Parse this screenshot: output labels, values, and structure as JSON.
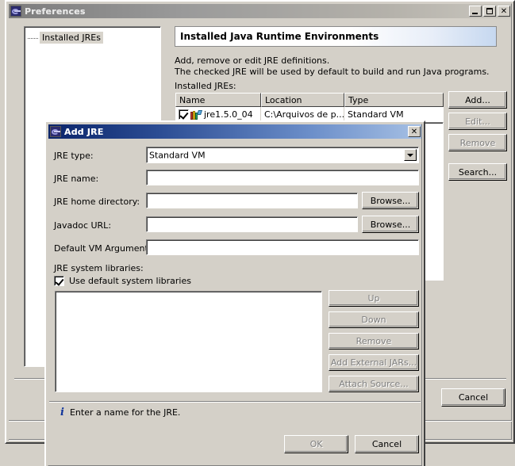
{
  "preferences_window": {
    "title": "Preferences",
    "icon": "eclipse-icon",
    "titlebar_buttons": [
      {
        "name": "minimize-button",
        "label": "_"
      },
      {
        "name": "maximize-button",
        "label": "□"
      },
      {
        "name": "close-button",
        "label": "✕"
      }
    ],
    "tree": {
      "items": [
        {
          "label": "Installed JREs",
          "selected": true
        }
      ]
    },
    "page": {
      "banner_title": "Installed Java Runtime Environments",
      "description_line1": "Add, remove or edit JRE definitions.",
      "description_line2": "The checked JRE will be used by default to build and run Java programs.",
      "table_label": "Installed JREs:",
      "table": {
        "columns": [
          "Name",
          "Location",
          "Type"
        ],
        "rows": [
          {
            "checked": true,
            "name": "jre1.5.0_04",
            "location": "C:\\Arquivos de p...",
            "type": "Standard VM"
          }
        ]
      },
      "side_buttons": [
        {
          "label": "Add...",
          "enabled": true,
          "name": "add-jre-button"
        },
        {
          "label": "Edit...",
          "enabled": false,
          "name": "edit-jre-button"
        },
        {
          "label": "Remove",
          "enabled": false,
          "name": "remove-jre-button"
        },
        {
          "label": "Search...",
          "enabled": true,
          "name": "search-jre-button"
        }
      ]
    },
    "footer_buttons": [
      {
        "label": "Cancel",
        "enabled": true,
        "name": "prefs-cancel-button"
      }
    ]
  },
  "add_jre_dialog": {
    "title": "Add JRE",
    "icon": "eclipse-icon",
    "close_label": "✕",
    "fields": {
      "jre_type_label": "JRE type:",
      "jre_type_value": "Standard VM",
      "jre_name_label": "JRE name:",
      "jre_name_value": "",
      "jre_home_label": "JRE home directory:",
      "jre_home_value": "",
      "jre_home_browse": "Browse...",
      "javadoc_label": "Javadoc URL:",
      "javadoc_value": "",
      "javadoc_browse": "Browse...",
      "vm_args_label": "Default VM Arguments:",
      "vm_args_value": ""
    },
    "libraries": {
      "section_label": "JRE system libraries:",
      "checkbox_label": "Use default system libraries",
      "checkbox_checked": true,
      "list_items": [],
      "buttons": [
        {
          "label": "Up",
          "enabled": false,
          "name": "lib-up-button"
        },
        {
          "label": "Down",
          "enabled": false,
          "name": "lib-down-button"
        },
        {
          "label": "Remove",
          "enabled": false,
          "name": "lib-remove-button"
        },
        {
          "label": "Add External JARs...",
          "enabled": false,
          "name": "lib-add-external-jars-button"
        },
        {
          "label": "Attach Source...",
          "enabled": false,
          "name": "lib-attach-source-button"
        }
      ]
    },
    "status": {
      "icon": "info-icon",
      "message": "Enter a name for the JRE."
    },
    "footer_buttons": [
      {
        "label": "OK",
        "enabled": false,
        "name": "add-jre-ok-button"
      },
      {
        "label": "Cancel",
        "enabled": true,
        "name": "add-jre-cancel-button"
      }
    ]
  }
}
